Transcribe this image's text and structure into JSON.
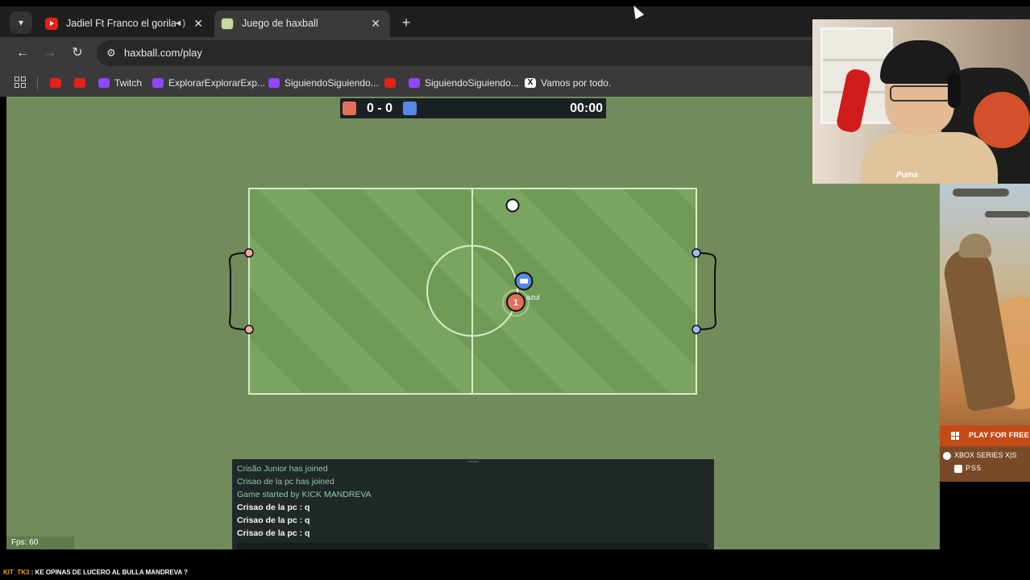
{
  "browser": {
    "tabs": [
      {
        "title": "Jadiel Ft Franco el gorila - Pa",
        "icon": "youtube-icon",
        "audio": true,
        "active": false
      },
      {
        "title": "Juego de haxball",
        "icon": "haxball-icon",
        "active": true
      }
    ],
    "new_tab_symbol": "+",
    "url": "haxball.com/play",
    "bookmarks": [
      {
        "label": "",
        "icon": "youtube-icon"
      },
      {
        "label": "",
        "icon": "youtube-icon"
      },
      {
        "label": "Twitch",
        "icon": "twitch-icon"
      },
      {
        "label": "ExplorarExplorarExp...",
        "icon": "twitch-icon"
      },
      {
        "label": "SiguiendoSiguiendo...",
        "icon": "twitch-icon"
      },
      {
        "label": "",
        "icon": "youtube-icon"
      },
      {
        "label": "SiguiendoSiguiendo...",
        "icon": "twitch-icon"
      },
      {
        "label": "Vamos por todo.",
        "icon": "x-icon"
      }
    ]
  },
  "game": {
    "score": "0 - 0",
    "timer": "00:00",
    "red_team_color": "#e56e56",
    "blue_team_color": "#5689e5",
    "players": [
      {
        "team": "red",
        "avatar": "1",
        "name": ""
      },
      {
        "team": "blue",
        "avatar": "",
        "name": "azul"
      }
    ],
    "fps": "Fps: 60",
    "chat": [
      {
        "type": "notice",
        "text": "Crisão Junior has joined"
      },
      {
        "type": "notice",
        "text": "Crisao de la pc has joined"
      },
      {
        "type": "notice",
        "text": "Game started by KICK MANDREVA"
      },
      {
        "type": "message",
        "text": "Crisao de la pc : q"
      },
      {
        "type": "message",
        "text": "Crisao de la pc : q"
      },
      {
        "type": "message",
        "text": "Crisao de la pc : q"
      }
    ]
  },
  "ad": {
    "cta": "PLAY FOR FREE",
    "platform_1": "XBOX SERIES X|S",
    "platform_2": "PS5"
  },
  "webcam": {
    "shirt_text": "Puma"
  },
  "ticker": {
    "user": "KIT_TK3",
    "separator": " : ",
    "text": "KE OPINAS DE LUCERO AL BULLA MANDREVA ?"
  }
}
